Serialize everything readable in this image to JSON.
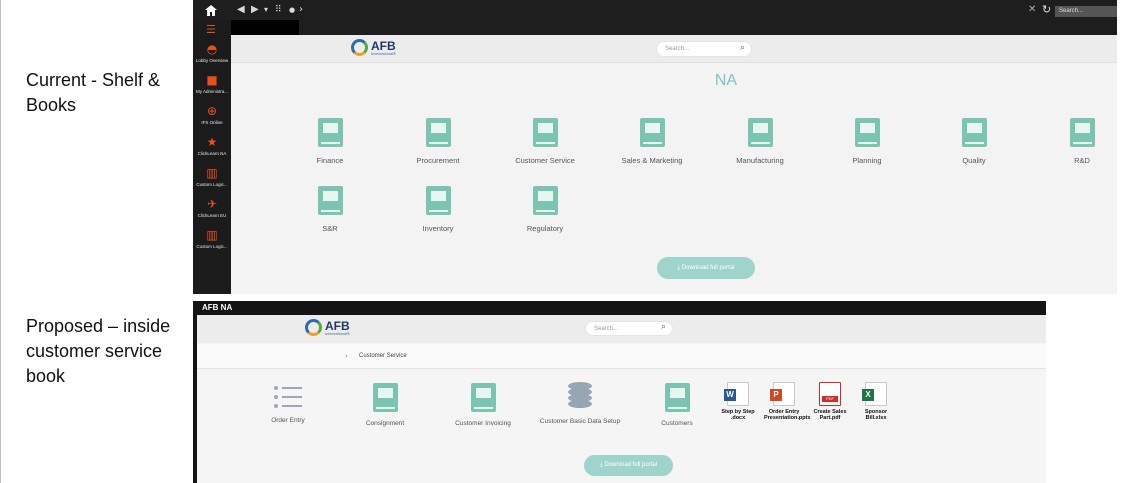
{
  "captions": {
    "current": "Current - Shelf & Books",
    "proposed": "Proposed – inside customer service book"
  },
  "current": {
    "topbar": {
      "search_placeholder": "Search...",
      "icons": [
        "home-icon",
        "back-icon",
        "forward-icon",
        "grid-icon",
        "close-icon",
        "refresh-icon"
      ]
    },
    "sidebar": {
      "items": [
        {
          "label": "Lobby Overview",
          "icon": "speedometer-icon"
        },
        {
          "label": "My Administra...",
          "icon": "truck-icon"
        },
        {
          "label": "IFS Online",
          "icon": "globe-icon"
        },
        {
          "label": "ClickLearn NA",
          "icon": "star-icon"
        },
        {
          "label": "Custom Logic...",
          "icon": "bar-chart-icon"
        },
        {
          "label": "ClickLearn EU",
          "icon": "airplane-icon"
        },
        {
          "label": "Custom Logic...",
          "icon": "bar-chart-icon"
        }
      ]
    },
    "logo": {
      "name": "AFB",
      "sub": "International®"
    },
    "search_placeholder": "Search...",
    "title": "NA",
    "books": [
      "Finance",
      "Procurement",
      "Customer Service",
      "Sales & Marketing",
      "Manufacturing",
      "Planning",
      "Quality",
      "R&D",
      "S&R",
      "Inventory",
      "Regulatory"
    ],
    "download_label": "Download full portal"
  },
  "proposed": {
    "window_title": "AFB NA",
    "logo": {
      "name": "AFB",
      "sub": "International®"
    },
    "search_placeholder": "Search...",
    "breadcrumb": "Customer Service",
    "items": [
      {
        "label": "Order Entry",
        "icon": "list-icon"
      },
      {
        "label": "Consignment",
        "icon": "book-icon"
      },
      {
        "label": "Customer Invoicing",
        "icon": "book-icon"
      },
      {
        "label": "Customer Basic Data Setup",
        "icon": "database-icon"
      },
      {
        "label": "Customers",
        "icon": "book-icon"
      }
    ],
    "files": [
      {
        "label": "Step by Step .docx",
        "icon": "word-file-icon",
        "color": "#2b579a",
        "badge": "W"
      },
      {
        "label": "Order Entry Presentation.pptx",
        "icon": "powerpoint-file-icon",
        "color": "#d24726",
        "badge": "P"
      },
      {
        "label": "Create Sales Part.pdf",
        "icon": "pdf-file-icon",
        "color": "#d12b2b",
        "badge": "PDF"
      },
      {
        "label": "Sponsor Bill.xlsx",
        "icon": "excel-file-icon",
        "color": "#217346",
        "badge": "X"
      }
    ],
    "download_label": "Download full portal"
  }
}
